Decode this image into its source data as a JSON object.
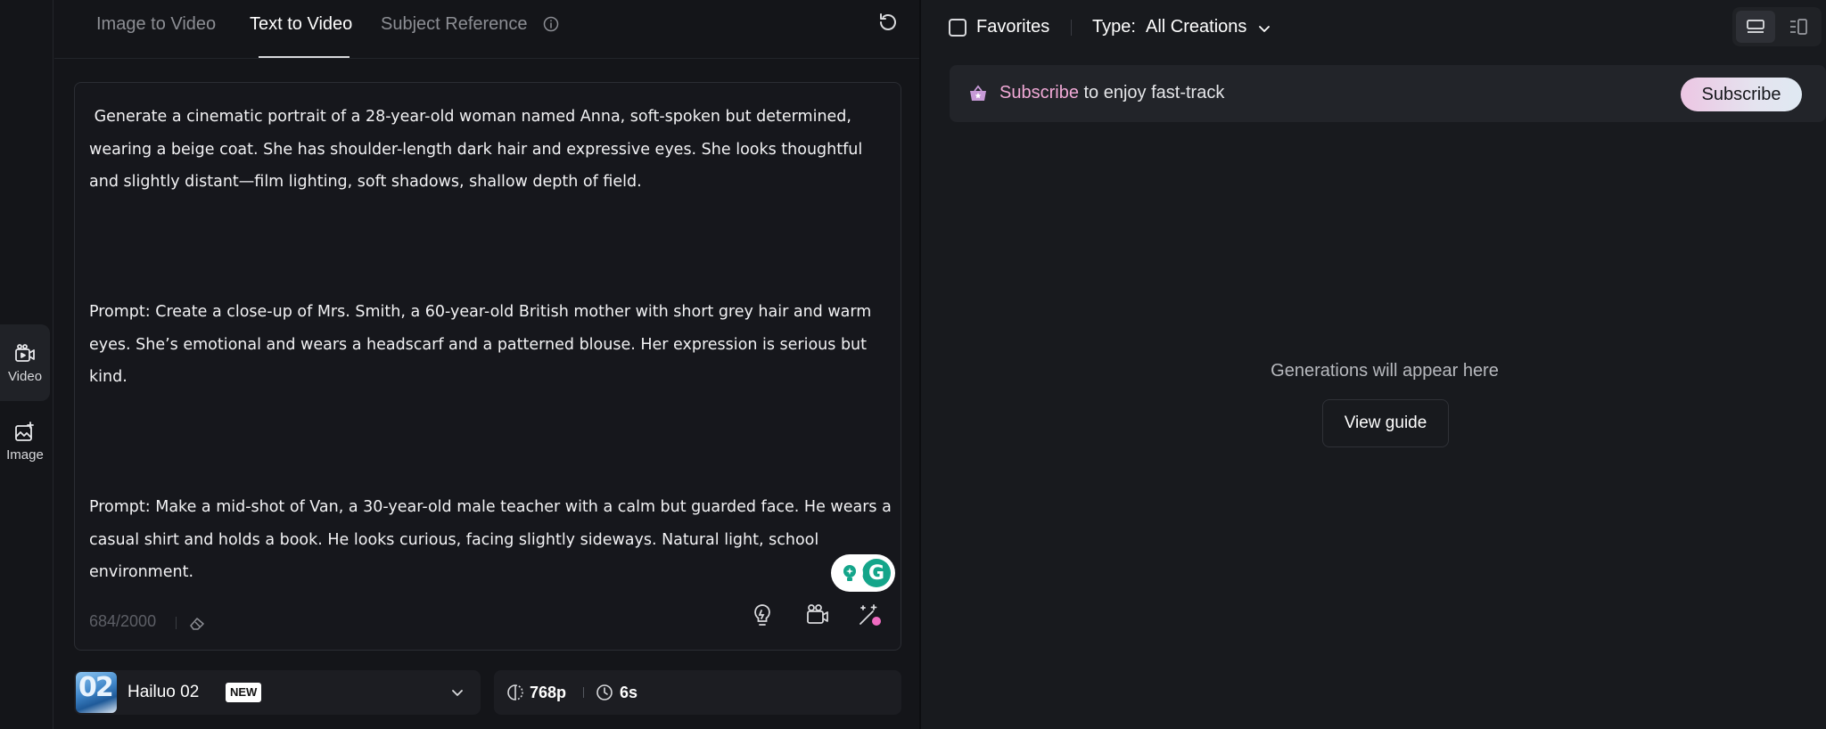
{
  "rail": {
    "items": [
      {
        "label": "Video",
        "icon": "video-icon"
      },
      {
        "label": "Image",
        "icon": "image-icon"
      }
    ]
  },
  "tabs": [
    {
      "label": "Image to Video"
    },
    {
      "label": "Text to Video"
    },
    {
      "label": "Subject Reference"
    }
  ],
  "active_tab": "Text to Video",
  "prompt": {
    "text": " Generate a cinematic portrait of a 28-year-old woman named Anna, soft-spoken but determined, wearing a beige coat. She has shoulder-length dark hair and expressive eyes. She looks thoughtful and slightly distant—film lighting, soft shadows, shallow depth of field.\n\n\n\nPrompt: Create a close-up of Mrs. Smith, a 60-year-old British mother with short grey hair and warm eyes. She’s emotional and wears a headscarf and a patterned blouse. Her expression is serious but kind.\n\n\n\nPrompt: Make a mid-shot of Van, a 30-year-old male teacher with a calm but guarded face. He wears a casual shirt and holds a book. He looks curious, facing slightly sideways. Natural light, school environment.",
    "counter": "684/2000"
  },
  "model": {
    "thumb_text": "02",
    "name": "Hailuo 02",
    "badge": "NEW"
  },
  "settings": {
    "resolution": "768p",
    "duration": "6s"
  },
  "right": {
    "favorites_label": "Favorites",
    "type_label": "Type:",
    "type_value": "All Creations",
    "subscribe_banner": {
      "accent": "Subscribe",
      "text": " to enjoy fast-track",
      "button": "Subscribe"
    },
    "empty_title": "Generations will appear here",
    "guide_button": "View guide"
  },
  "colors": {
    "background": "#141519",
    "panel": "#181a1e",
    "accent_pink": "#f1a9d6",
    "grammarly": "#14a58a"
  }
}
